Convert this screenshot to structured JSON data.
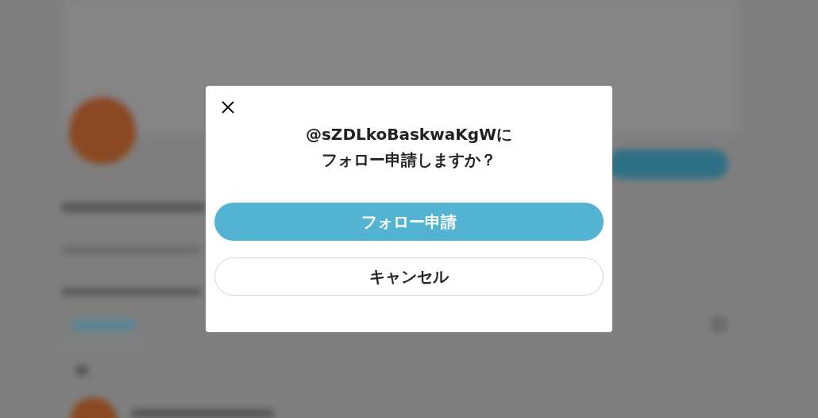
{
  "dialog": {
    "title_lines": [
      "@sZDLkoBaskwaKgWに",
      "フォロー申請しますか？"
    ],
    "buttons": [
      {
        "label": "フォロー申請",
        "kind": "primary"
      },
      {
        "label": "キャンセル",
        "kind": "secondary"
      }
    ]
  }
}
